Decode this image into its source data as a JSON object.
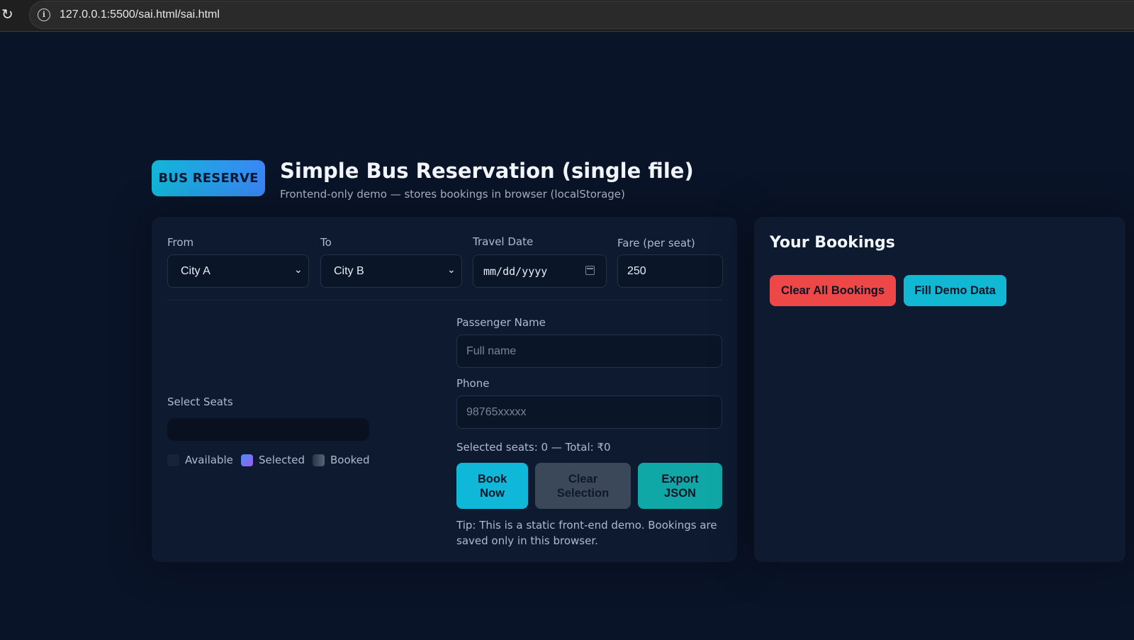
{
  "browser": {
    "url": "127.0.0.1:5500/sai.html/sai.html"
  },
  "header": {
    "logo": "BUS RESERVE",
    "title": "Simple Bus Reservation (single file)",
    "subtitle": "Frontend-only demo — stores bookings in browser (localStorage)"
  },
  "trip": {
    "from_label": "From",
    "from_value": "City A",
    "to_label": "To",
    "to_value": "City B",
    "date_label": "Travel Date",
    "date_value": "mm/dd/yyyy",
    "fare_label": "Fare (per seat)",
    "fare_value": "250"
  },
  "seats": {
    "label": "Select Seats",
    "legend_available": "Available",
    "legend_selected": "Selected",
    "legend_booked": "Booked"
  },
  "passenger": {
    "name_label": "Passenger Name",
    "name_placeholder": "Full name",
    "phone_label": "Phone",
    "phone_placeholder": "98765xxxxx",
    "summary": "Selected seats: 0 — Total: ₹0",
    "book_label": "Book Now",
    "clear_label": "Clear Selection",
    "export_label": "Export JSON",
    "tip": "Tip: This is a static front-end demo. Bookings are saved only in this browser."
  },
  "bookings": {
    "title": "Your Bookings",
    "clear_all_label": "Clear All Bookings",
    "demo_label": "Fill Demo Data"
  },
  "colors": {
    "background": "#0a1428",
    "panel": "#0d1a30",
    "accent_cyan": "#0fb8d8",
    "danger": "#ee4747",
    "teal": "#10a8a6"
  }
}
